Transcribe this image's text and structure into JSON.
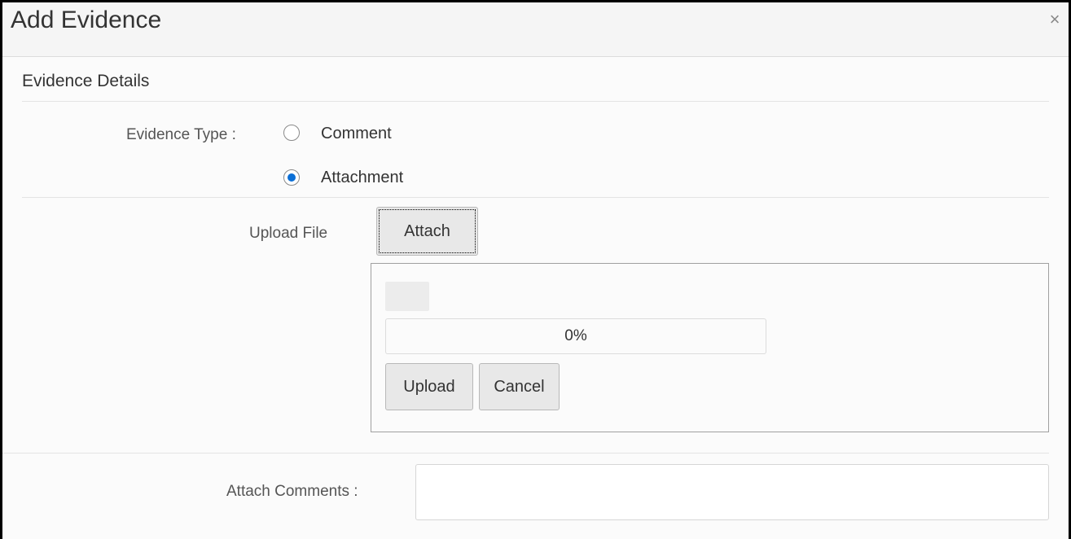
{
  "dialog": {
    "title": "Add Evidence",
    "close_symbol": "×"
  },
  "section": {
    "title": "Evidence Details"
  },
  "evidence_type": {
    "label": "Evidence Type :",
    "options": [
      {
        "label": "Comment",
        "checked": false
      },
      {
        "label": "Attachment",
        "checked": true
      }
    ]
  },
  "upload": {
    "label": "Upload File",
    "attach_button": "Attach",
    "progress_text": "0%",
    "progress_value": 0,
    "upload_button": "Upload",
    "cancel_button": "Cancel"
  },
  "comments": {
    "label": "Attach Comments :",
    "value": ""
  },
  "colors": {
    "accent": "#0b6fd6"
  },
  "icons": {
    "close": "close-icon"
  }
}
